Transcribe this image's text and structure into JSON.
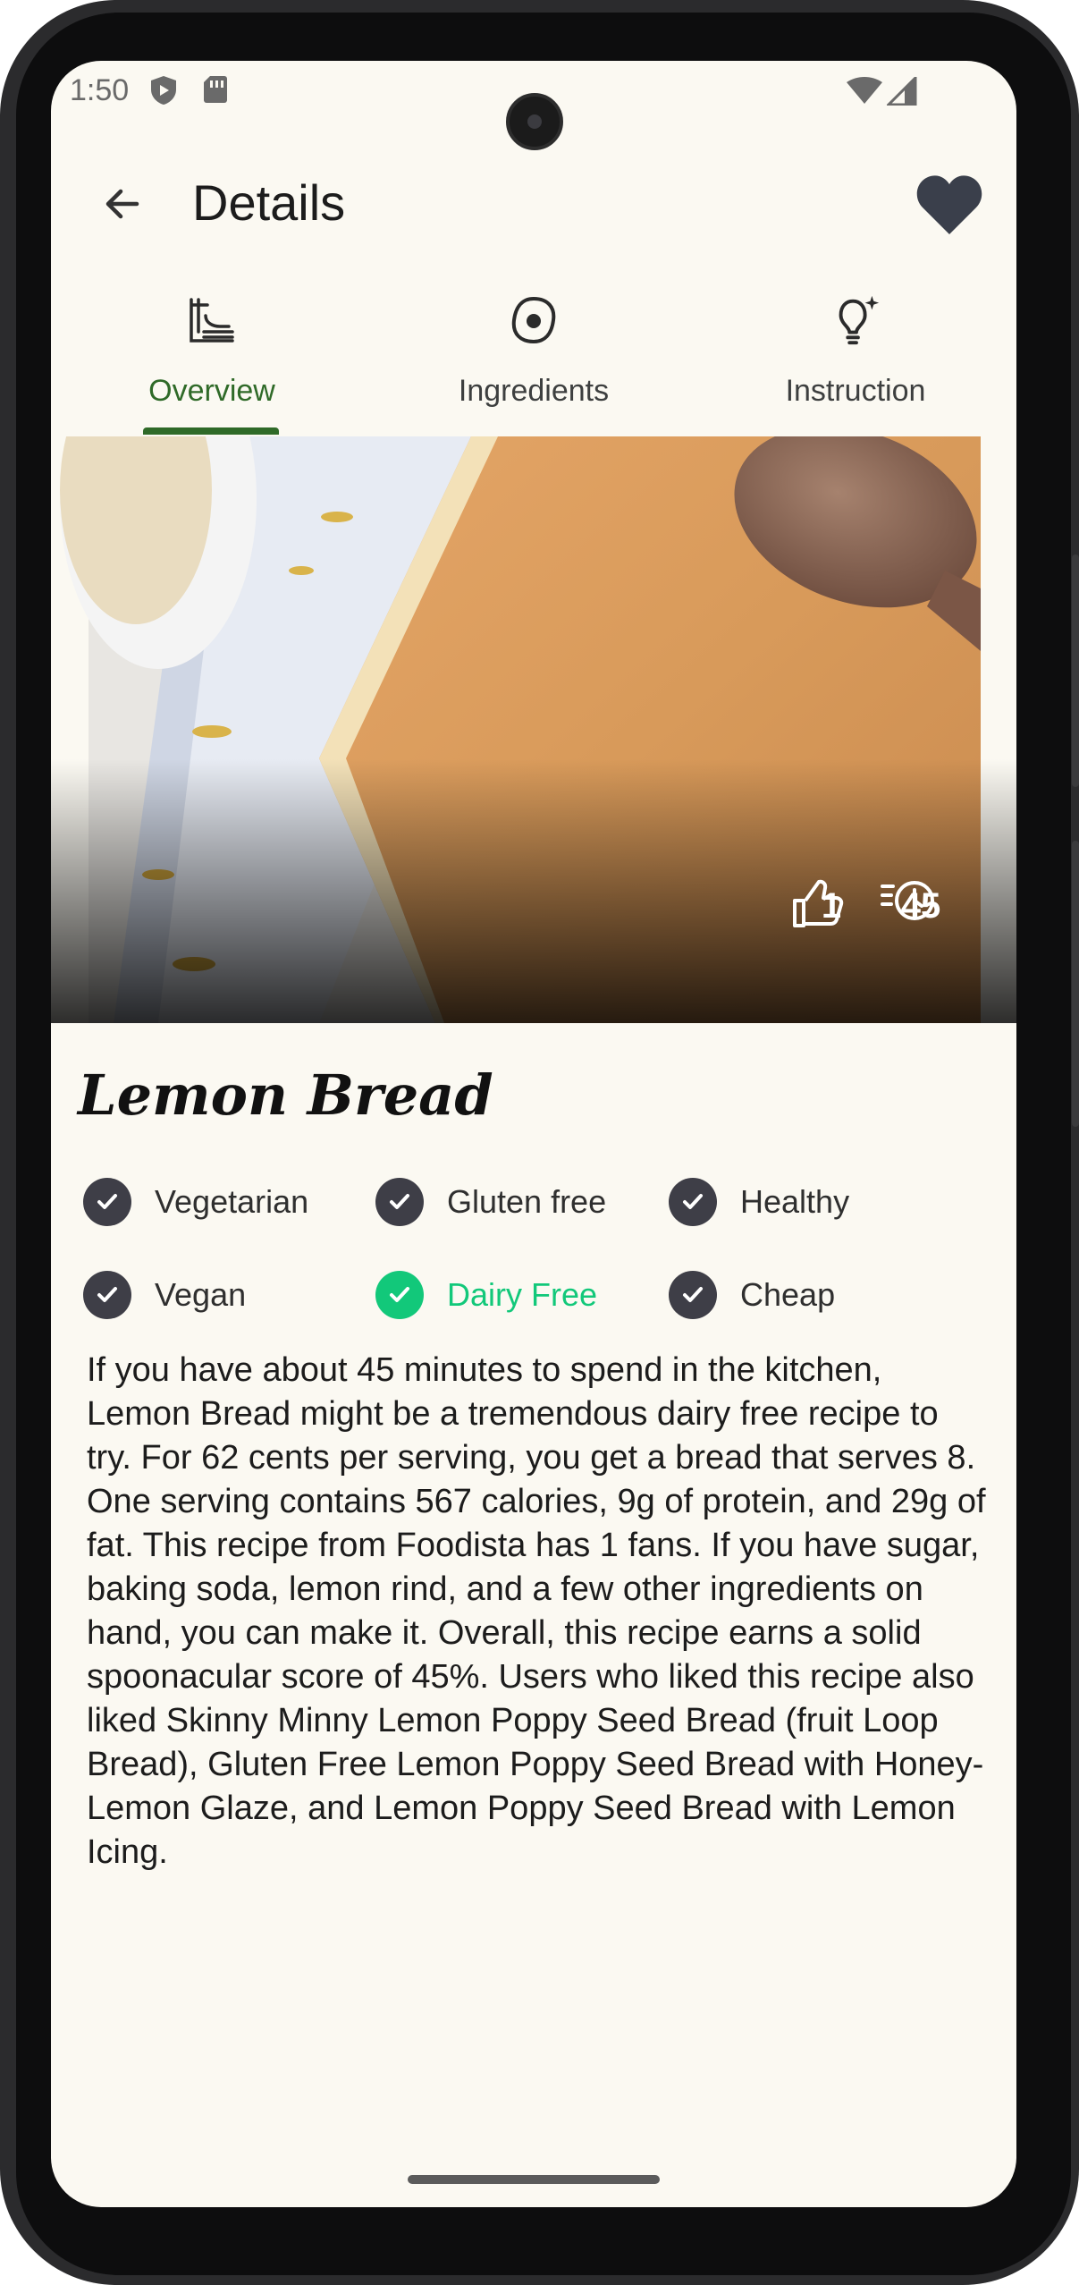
{
  "status_bar": {
    "time": "1:50"
  },
  "app_bar": {
    "title": "Details"
  },
  "tabs": [
    {
      "label": "Overview",
      "icon": "table-icon",
      "active": true
    },
    {
      "label": "Ingredients",
      "icon": "egg-icon",
      "active": false
    },
    {
      "label": "Instruction",
      "icon": "lightbulb-icon",
      "active": false
    }
  ],
  "hero": {
    "likes": "1",
    "minutes": "45"
  },
  "recipe": {
    "title": "Lemon Bread",
    "badges": [
      {
        "label": "Vegetarian",
        "active": false
      },
      {
        "label": "Gluten free",
        "active": false
      },
      {
        "label": "Healthy",
        "active": false
      },
      {
        "label": "Vegan",
        "active": false
      },
      {
        "label": "Dairy Free",
        "active": true
      },
      {
        "label": "Cheap",
        "active": false
      }
    ],
    "summary": "If you have about 45 minutes to spend in the kitchen, Lemon Bread might be a tremendous dairy free recipe to try. For 62 cents per serving, you get a bread that serves 8. One serving contains 567 calories, 9g of protein, and 29g of fat. This recipe from Foodista has 1 fans. If you have sugar, baking soda, lemon rind, and a few other ingredients on hand, you can make it. Overall, this recipe earns a solid spoonacular score of 45%. Users who liked this recipe also liked Skinny Minny Lemon Poppy Seed Bread (fruit Loop Bread), Gluten Free Lemon Poppy Seed Bread with Honey-Lemon Glaze, and Lemon Poppy Seed Bread with Lemon Icing."
  },
  "colors": {
    "accent_green": "#2f6a28",
    "active_badge": "#12c87a",
    "inactive_badge": "#3e3e47",
    "background": "#fbf9f2"
  }
}
